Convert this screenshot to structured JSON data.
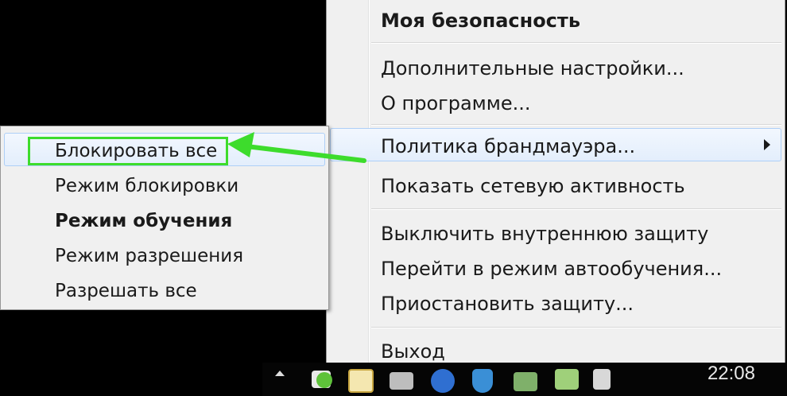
{
  "main_menu": {
    "items": [
      {
        "label": "Моя безопасность",
        "bold": true
      },
      {
        "label": "Дополнительные настройки..."
      },
      {
        "label": "О программе..."
      },
      {
        "label": "Политика брандмауэра...",
        "has_submenu": true,
        "highlighted": true
      },
      {
        "label": "Показать сетевую активность"
      },
      {
        "label": "Выключить внутреннюю защиту"
      },
      {
        "label": "Перейти в режим автообучения..."
      },
      {
        "label": "Приостановить защиту..."
      },
      {
        "label": "Выход"
      }
    ]
  },
  "submenu": {
    "items": [
      {
        "label": "Блокировать все",
        "highlighted": true,
        "annotated": true
      },
      {
        "label": "Режим блокировки"
      },
      {
        "label": "Режим обучения",
        "bold": true
      },
      {
        "label": "Режим разрешения"
      },
      {
        "label": "Разрешать все"
      }
    ]
  },
  "annotation": {
    "color": "#3ddc2c"
  },
  "taskbar": {
    "clock": "22:08",
    "tray_icons": [
      "show-hidden-icons",
      "green-dot-icon",
      "chart-icon",
      "network-activity-icon",
      "p-app-icon",
      "shield-icon",
      "security-icon",
      "wifi-icon",
      "volume-icon"
    ]
  }
}
